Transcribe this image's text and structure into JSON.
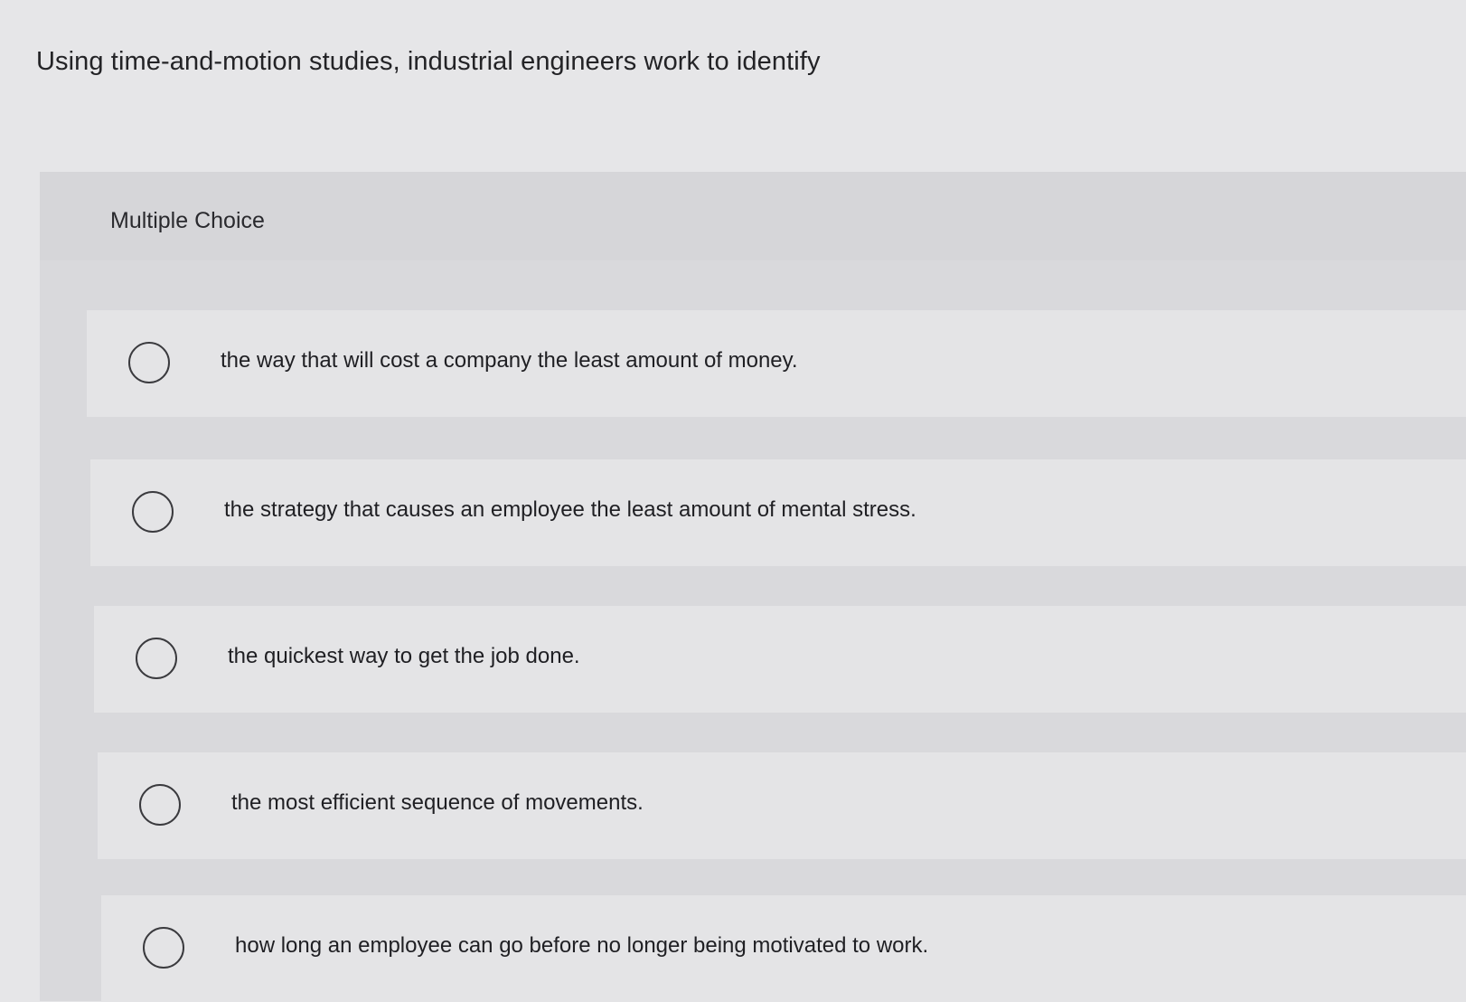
{
  "question": {
    "text": "Using time-and-motion studies, industrial engineers work to identify"
  },
  "section": {
    "label": "Multiple Choice"
  },
  "options": [
    {
      "text": "the way that will cost a company the least amount of money."
    },
    {
      "text": "the strategy that causes an employee the least amount of mental stress."
    },
    {
      "text": "the quickest way to get the job done."
    },
    {
      "text": "the most efficient sequence of movements."
    },
    {
      "text": "how long an employee can go before no longer being motivated to work."
    }
  ]
}
